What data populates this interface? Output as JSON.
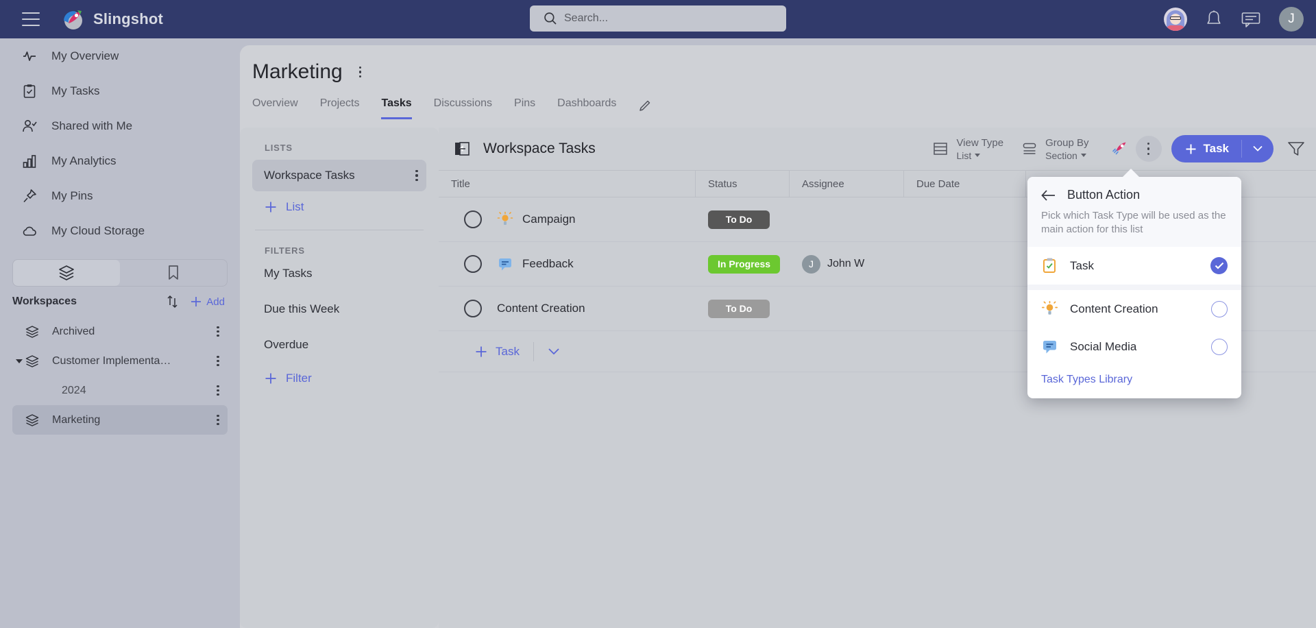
{
  "app": {
    "brand": "Slingshot",
    "colors": {
      "header_bg": "#313a6b",
      "accent": "#5a67d8",
      "status_todo_dark": "#575757",
      "status_todo_grey": "#9b9b9b",
      "status_progress": "#6cc830"
    }
  },
  "search": {
    "placeholder": "Search...",
    "value": ""
  },
  "topbar": {
    "menu_icon": "hamburger-icon",
    "logo_icon": "slingshot-rocket-logo",
    "notifications_icon": "bell-icon",
    "messages_icon": "chat-icon",
    "user_initial": "J"
  },
  "sidebar": {
    "items": [
      {
        "label": "My Overview",
        "icon": "activity-icon"
      },
      {
        "label": "My Tasks",
        "icon": "clipboard-check-icon"
      },
      {
        "label": "Shared with Me",
        "icon": "user-check-icon"
      },
      {
        "label": "My Analytics",
        "icon": "bar-chart-icon"
      },
      {
        "label": "My Pins",
        "icon": "pin-icon"
      },
      {
        "label": "My Cloud Storage",
        "icon": "cloud-icon"
      }
    ],
    "toggle": {
      "left_icon": "layers-icon",
      "right_icon": "bookmark-icon",
      "active": "left"
    },
    "workspaces": {
      "title": "Workspaces",
      "sort_icon": "sort-arrows-icon",
      "add_label": "Add",
      "items": [
        {
          "label": "Archived",
          "icon": "layers-icon",
          "level": 0,
          "expandable": false,
          "selected": false
        },
        {
          "label": "Customer Implementa…",
          "icon": "layers-icon",
          "level": 0,
          "expandable": true,
          "expanded": true,
          "selected": false
        },
        {
          "label": "2024",
          "icon": "",
          "level": 1,
          "expandable": false,
          "selected": false
        },
        {
          "label": "Marketing",
          "icon": "layers-icon",
          "level": 0,
          "expandable": false,
          "selected": true
        }
      ]
    }
  },
  "page": {
    "title": "Marketing",
    "tabs": [
      {
        "label": "Overview",
        "active": false
      },
      {
        "label": "Projects",
        "active": false
      },
      {
        "label": "Tasks",
        "active": true
      },
      {
        "label": "Discussions",
        "active": false
      },
      {
        "label": "Pins",
        "active": false
      },
      {
        "label": "Dashboards",
        "active": false
      }
    ],
    "edit_icon": "pencil-icon"
  },
  "lists_panel": {
    "lists_label": "LISTS",
    "lists": [
      {
        "label": "Workspace Tasks",
        "selected": true
      }
    ],
    "add_list_label": "List",
    "filters_label": "FILTERS",
    "filters": [
      {
        "label": "My Tasks"
      },
      {
        "label": "Due this Week"
      },
      {
        "label": "Overdue"
      }
    ],
    "add_filter_label": "Filter"
  },
  "task_panel": {
    "heading": "Workspace Tasks",
    "collapse_icon": "collapse-panel-icon",
    "view_type": {
      "label": "View Type",
      "value": "List",
      "icon": "rows-icon"
    },
    "group_by": {
      "label": "Group By",
      "value": "Section",
      "icon": "group-icon"
    },
    "rocket_icon": "rocket-icon",
    "more_icon": "kebab-icon",
    "primary_button": {
      "label": "Task",
      "plus": "+",
      "caret": "chevron-down-icon"
    },
    "filter_icon": "funnel-icon",
    "columns": [
      "Title",
      "Status",
      "Assignee",
      "Due Date"
    ],
    "add_column_icon": "plus-icon",
    "rows": [
      {
        "title": "Campaign",
        "type_icon": "lightbulb-icon",
        "status": "To Do",
        "status_color": "#575757",
        "assignee": "",
        "assignee_initial": "",
        "due": ""
      },
      {
        "title": "Feedback",
        "type_icon": "speech-bubble-icon",
        "status": "In Progress",
        "status_color": "#6cc830",
        "assignee": "John W",
        "assignee_initial": "J",
        "due": ""
      },
      {
        "title": "Content Creation",
        "type_icon": "",
        "status": "To Do",
        "status_color": "#9b9b9b",
        "assignee": "",
        "assignee_initial": "",
        "due": ""
      }
    ],
    "add_task_label": "Task",
    "add_task_caret": "chevron-down-icon"
  },
  "popover": {
    "back_icon": "arrow-left-icon",
    "title": "Button Action",
    "subtitle": "Pick which Task Type will be used as the main action for this list",
    "options": [
      {
        "label": "Task",
        "icon": "clipboard-task-icon",
        "selected": true
      },
      {
        "label": "Content Creation",
        "icon": "lightbulb-icon",
        "selected": false
      },
      {
        "label": "Social Media",
        "icon": "speech-bubble-icon",
        "selected": false
      }
    ],
    "link": "Task Types Library"
  }
}
